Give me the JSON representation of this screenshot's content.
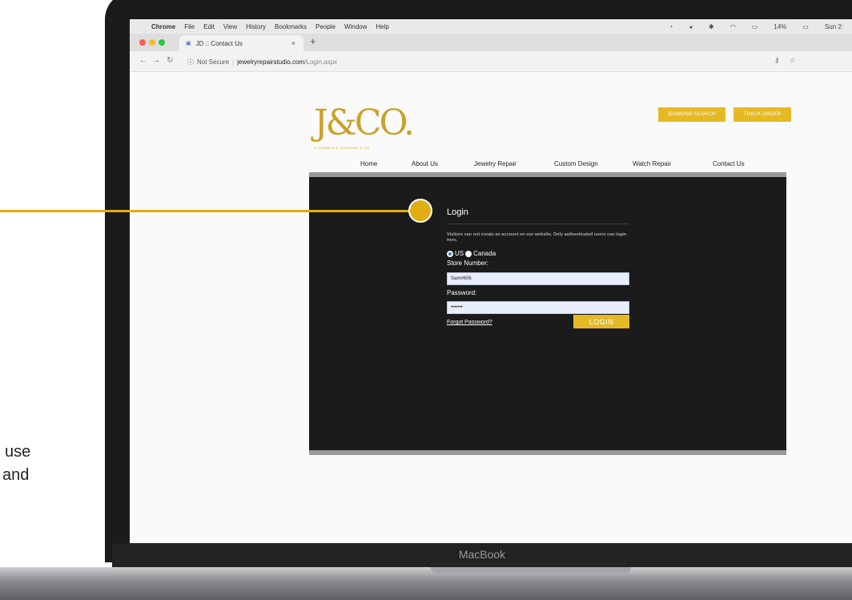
{
  "slide": {
    "line1": "use",
    "line2": "and"
  },
  "laptop": {
    "brand": "MacBook"
  },
  "macos": {
    "apple_symbol": "",
    "menus": [
      "Chrome",
      "File",
      "Edit",
      "View",
      "History",
      "Bookmarks",
      "People",
      "Window",
      "Help"
    ],
    "battery": "14%",
    "clock": "Sun 2:"
  },
  "browser": {
    "tab_title": "JD :: Contact Us",
    "tab_close": "×",
    "new_tab": "+",
    "security": "Not Secure",
    "url_domain": "jewelryrepairstudio.com",
    "url_path": "/Login.aspx"
  },
  "site": {
    "logo": "J&CO.",
    "logo_tagline": "A TRIMBOO'S GOLDSMITH CO.",
    "top_buttons": [
      "DIAMOND SEARCH",
      "TRACK ORDER"
    ],
    "nav": [
      "Home",
      "About Us",
      "Jewelry Repair",
      "Custom Design",
      "Watch Repair",
      "Contact Us"
    ],
    "login": {
      "title": "Login",
      "note": "Visitors can not create an account on our website. Only authenticated users can login here.",
      "radio_us": "US",
      "radio_canada": "Canada",
      "store_label": "Store Number:",
      "store_value": "Sam#606",
      "password_label": "Password:",
      "password_value": "•••••••",
      "forgot": "Forgot Password?",
      "submit": "LOGIN"
    }
  },
  "colors": {
    "accent_gold": "#e5b924",
    "callout": "#e0ad13",
    "panel": "#1b1b1b",
    "radio_selected": "#2f7fe0"
  }
}
